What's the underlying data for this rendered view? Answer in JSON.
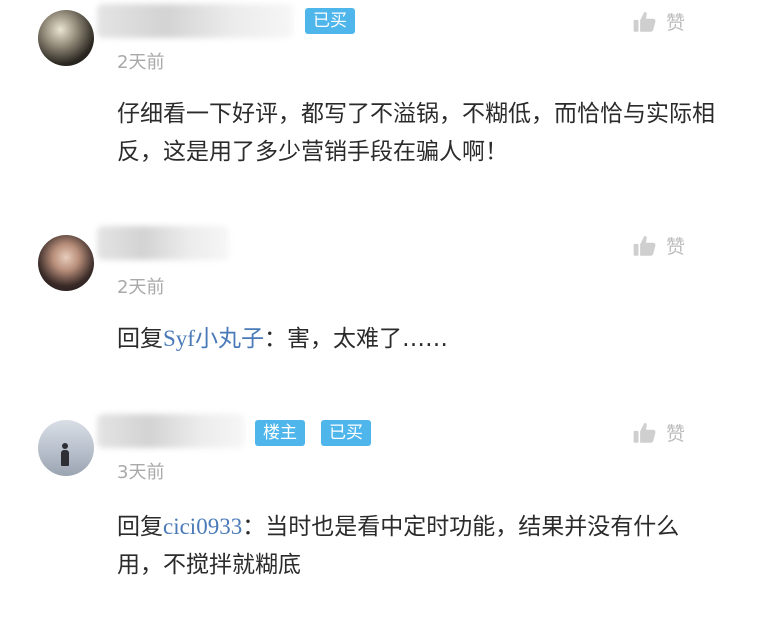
{
  "comments": [
    {
      "tags": [
        "已买"
      ],
      "time": "2天前",
      "like_label": "赞",
      "text": "仔细看一下好评，都写了不溢锅，不糊低，而恰恰与实际相反，这是用了多少营销手段在骗人啊！"
    },
    {
      "tags": [],
      "time": "2天前",
      "like_label": "赞",
      "reply_prefix": "回复",
      "reply_to": "Syf小丸子",
      "reply_sep": "：",
      "text": "害，太难了……"
    },
    {
      "tags": [
        "楼主",
        "已买"
      ],
      "time": "3天前",
      "like_label": "赞",
      "reply_prefix": "回复",
      "reply_to": "cici0933",
      "reply_sep": "：",
      "text": "当时也是看中定时功能，结果并没有什么用，不搅拌就糊底"
    }
  ],
  "colors": {
    "tag": "#4fb6ec",
    "reply_user": "#4a7ab8",
    "time": "#a9a9a9",
    "like": "#bdbdbd"
  }
}
